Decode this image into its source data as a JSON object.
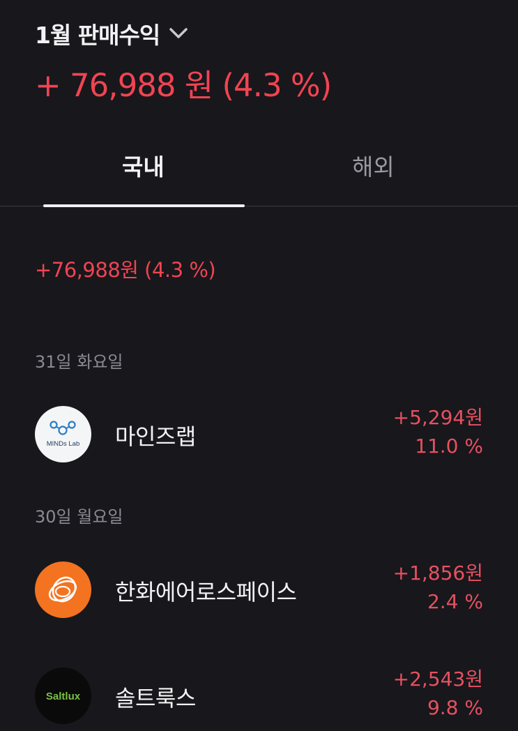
{
  "header": {
    "title": "1월 판매수익",
    "summary": "+ 76,988 원 (4.3 %)"
  },
  "tabs": [
    {
      "label": "국내",
      "active": true
    },
    {
      "label": "해외",
      "active": false
    }
  ],
  "domestic_summary": "+76,988원 (4.3 %)",
  "groups": [
    {
      "date": "31일 화요일",
      "items": [
        {
          "name": "마인즈랩",
          "amount": "+5,294원",
          "pct": "11.0 %",
          "logo_text": "MINDs Lab",
          "logo_icon": "minds-lab-logo"
        }
      ]
    },
    {
      "date": "30일 월요일",
      "items": [
        {
          "name": "한화에어로스페이스",
          "amount": "+1,856원",
          "pct": "2.4 %",
          "logo_icon": "hanwha-logo"
        },
        {
          "name": "솔트룩스",
          "amount": "+2,543원",
          "pct": "9.8 %",
          "logo_text": "Saltlux",
          "logo_icon": "saltlux-logo"
        }
      ]
    }
  ],
  "colors": {
    "background": "#18171c",
    "profit": "#f04452",
    "hanwha_orange": "#f37321",
    "saltlux_green": "#7ac143"
  }
}
